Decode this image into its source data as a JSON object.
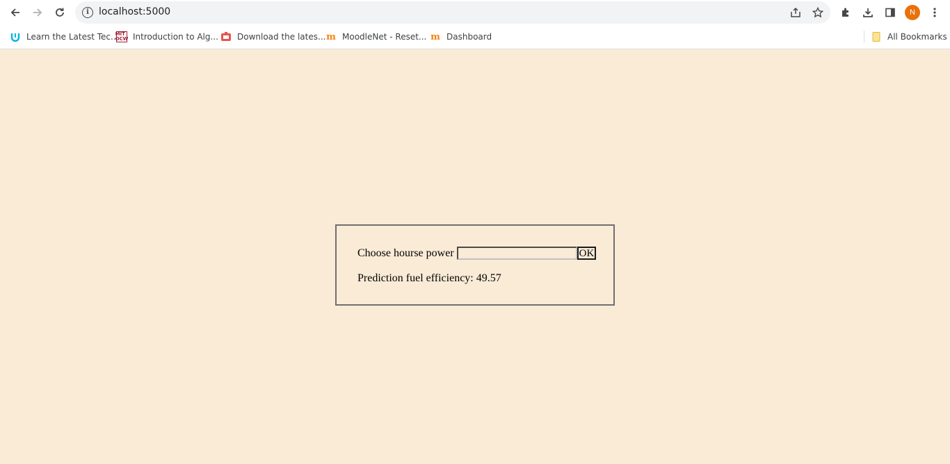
{
  "browser": {
    "url": "localhost:5000",
    "avatar_initial": "N",
    "bookmarks": [
      {
        "label": "Learn the Latest Tec...",
        "icon": "udacity-icon"
      },
      {
        "label": "Introduction to Alg...",
        "icon": "mit-ocw-icon"
      },
      {
        "label": "Download the lates...",
        "icon": "download-site-icon"
      },
      {
        "label": "MoodleNet - Reset...",
        "icon": "moodle-icon"
      },
      {
        "label": "Dashboard",
        "icon": "moodle-icon"
      }
    ],
    "all_bookmarks_label": "All Bookmarks"
  },
  "form": {
    "label": "Choose hourse power",
    "input_value": "",
    "button_label": "OK",
    "result_label": "Prediction fuel efficiency: 49.57"
  },
  "colors": {
    "page_background": "#faebd7",
    "avatar": "#e8710a"
  }
}
